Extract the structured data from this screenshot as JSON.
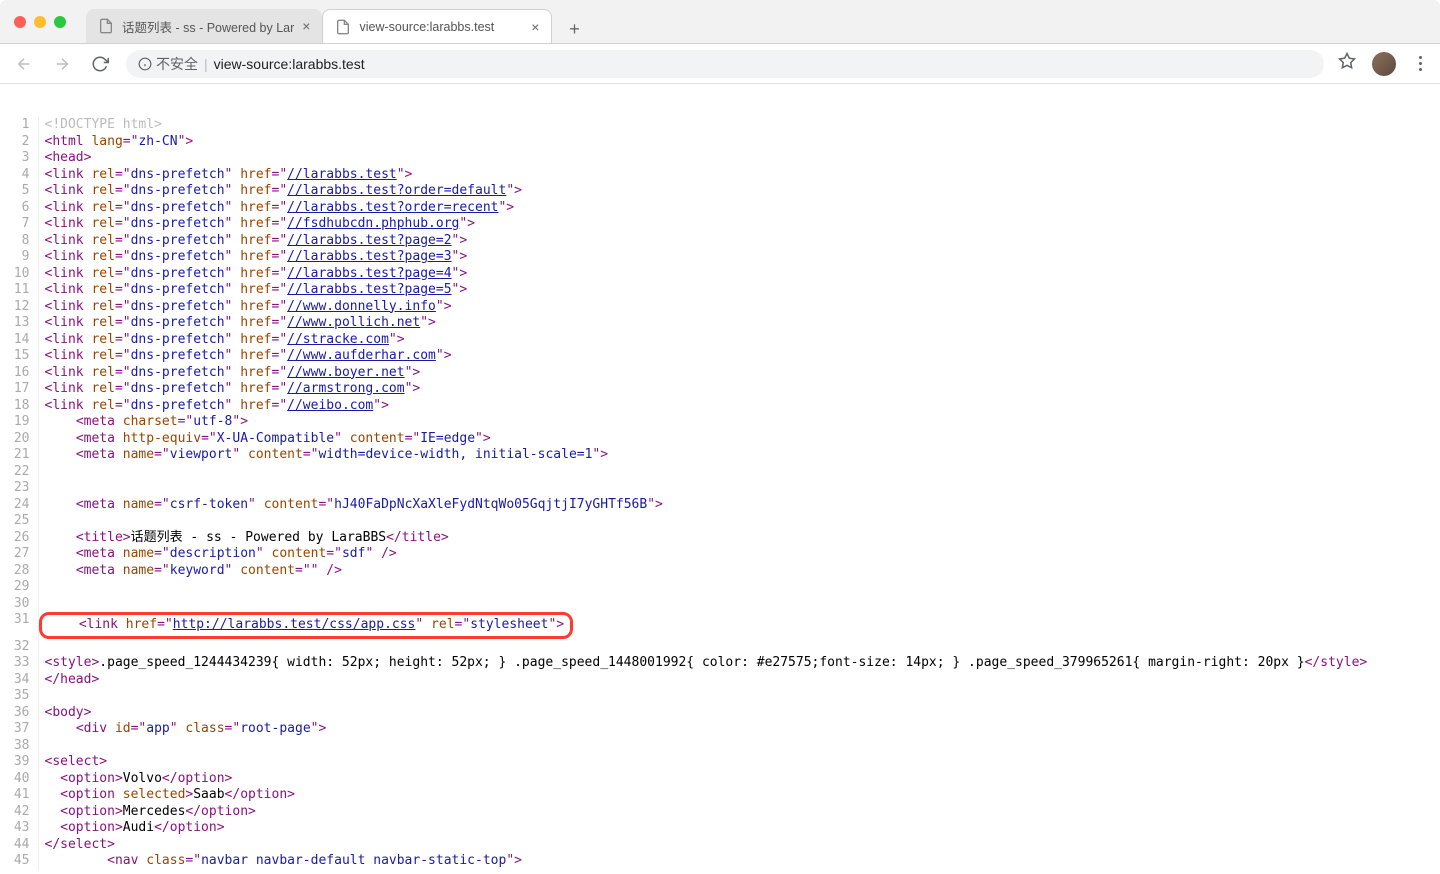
{
  "tabs": [
    {
      "title": "话题列表 - ss - Powered by Lar",
      "active": false
    },
    {
      "title": "view-source:larabbs.test",
      "active": true
    }
  ],
  "addressbar": {
    "security_label": "不安全",
    "url_prefix": "view-source:",
    "url_host": "larabbs.test"
  },
  "source_lines": [
    {
      "n": 1,
      "segs": [
        {
          "t": "doctype",
          "v": "<!DOCTYPE html>"
        }
      ]
    },
    {
      "n": 2,
      "segs": [
        {
          "t": "tag",
          "v": "<html "
        },
        {
          "t": "attr",
          "v": "lang"
        },
        {
          "t": "tag",
          "v": "=\""
        },
        {
          "t": "val",
          "v": "zh-CN"
        },
        {
          "t": "tag",
          "v": "\">"
        }
      ]
    },
    {
      "n": 3,
      "segs": [
        {
          "t": "tag",
          "v": "<head>"
        }
      ]
    },
    {
      "n": 4,
      "segs": [
        {
          "t": "tag",
          "v": "<link "
        },
        {
          "t": "attr",
          "v": "rel"
        },
        {
          "t": "tag",
          "v": "=\""
        },
        {
          "t": "val",
          "v": "dns-prefetch"
        },
        {
          "t": "tag",
          "v": "\" "
        },
        {
          "t": "attr",
          "v": "href"
        },
        {
          "t": "tag",
          "v": "=\""
        },
        {
          "t": "link",
          "v": "//larabbs.test"
        },
        {
          "t": "tag",
          "v": "\">"
        }
      ]
    },
    {
      "n": 5,
      "segs": [
        {
          "t": "tag",
          "v": "<link "
        },
        {
          "t": "attr",
          "v": "rel"
        },
        {
          "t": "tag",
          "v": "=\""
        },
        {
          "t": "val",
          "v": "dns-prefetch"
        },
        {
          "t": "tag",
          "v": "\" "
        },
        {
          "t": "attr",
          "v": "href"
        },
        {
          "t": "tag",
          "v": "=\""
        },
        {
          "t": "link",
          "v": "//larabbs.test?order=default"
        },
        {
          "t": "tag",
          "v": "\">"
        }
      ]
    },
    {
      "n": 6,
      "segs": [
        {
          "t": "tag",
          "v": "<link "
        },
        {
          "t": "attr",
          "v": "rel"
        },
        {
          "t": "tag",
          "v": "=\""
        },
        {
          "t": "val",
          "v": "dns-prefetch"
        },
        {
          "t": "tag",
          "v": "\" "
        },
        {
          "t": "attr",
          "v": "href"
        },
        {
          "t": "tag",
          "v": "=\""
        },
        {
          "t": "link",
          "v": "//larabbs.test?order=recent"
        },
        {
          "t": "tag",
          "v": "\">"
        }
      ]
    },
    {
      "n": 7,
      "segs": [
        {
          "t": "tag",
          "v": "<link "
        },
        {
          "t": "attr",
          "v": "rel"
        },
        {
          "t": "tag",
          "v": "=\""
        },
        {
          "t": "val",
          "v": "dns-prefetch"
        },
        {
          "t": "tag",
          "v": "\" "
        },
        {
          "t": "attr",
          "v": "href"
        },
        {
          "t": "tag",
          "v": "=\""
        },
        {
          "t": "link",
          "v": "//fsdhubcdn.phphub.org"
        },
        {
          "t": "tag",
          "v": "\">"
        }
      ]
    },
    {
      "n": 8,
      "segs": [
        {
          "t": "tag",
          "v": "<link "
        },
        {
          "t": "attr",
          "v": "rel"
        },
        {
          "t": "tag",
          "v": "=\""
        },
        {
          "t": "val",
          "v": "dns-prefetch"
        },
        {
          "t": "tag",
          "v": "\" "
        },
        {
          "t": "attr",
          "v": "href"
        },
        {
          "t": "tag",
          "v": "=\""
        },
        {
          "t": "link",
          "v": "//larabbs.test?page=2"
        },
        {
          "t": "tag",
          "v": "\">"
        }
      ]
    },
    {
      "n": 9,
      "segs": [
        {
          "t": "tag",
          "v": "<link "
        },
        {
          "t": "attr",
          "v": "rel"
        },
        {
          "t": "tag",
          "v": "=\""
        },
        {
          "t": "val",
          "v": "dns-prefetch"
        },
        {
          "t": "tag",
          "v": "\" "
        },
        {
          "t": "attr",
          "v": "href"
        },
        {
          "t": "tag",
          "v": "=\""
        },
        {
          "t": "link",
          "v": "//larabbs.test?page=3"
        },
        {
          "t": "tag",
          "v": "\">"
        }
      ]
    },
    {
      "n": 10,
      "segs": [
        {
          "t": "tag",
          "v": "<link "
        },
        {
          "t": "attr",
          "v": "rel"
        },
        {
          "t": "tag",
          "v": "=\""
        },
        {
          "t": "val",
          "v": "dns-prefetch"
        },
        {
          "t": "tag",
          "v": "\" "
        },
        {
          "t": "attr",
          "v": "href"
        },
        {
          "t": "tag",
          "v": "=\""
        },
        {
          "t": "link",
          "v": "//larabbs.test?page=4"
        },
        {
          "t": "tag",
          "v": "\">"
        }
      ]
    },
    {
      "n": 11,
      "segs": [
        {
          "t": "tag",
          "v": "<link "
        },
        {
          "t": "attr",
          "v": "rel"
        },
        {
          "t": "tag",
          "v": "=\""
        },
        {
          "t": "val",
          "v": "dns-prefetch"
        },
        {
          "t": "tag",
          "v": "\" "
        },
        {
          "t": "attr",
          "v": "href"
        },
        {
          "t": "tag",
          "v": "=\""
        },
        {
          "t": "link",
          "v": "//larabbs.test?page=5"
        },
        {
          "t": "tag",
          "v": "\">"
        }
      ]
    },
    {
      "n": 12,
      "segs": [
        {
          "t": "tag",
          "v": "<link "
        },
        {
          "t": "attr",
          "v": "rel"
        },
        {
          "t": "tag",
          "v": "=\""
        },
        {
          "t": "val",
          "v": "dns-prefetch"
        },
        {
          "t": "tag",
          "v": "\" "
        },
        {
          "t": "attr",
          "v": "href"
        },
        {
          "t": "tag",
          "v": "=\""
        },
        {
          "t": "link",
          "v": "//www.donnelly.info"
        },
        {
          "t": "tag",
          "v": "\">"
        }
      ]
    },
    {
      "n": 13,
      "segs": [
        {
          "t": "tag",
          "v": "<link "
        },
        {
          "t": "attr",
          "v": "rel"
        },
        {
          "t": "tag",
          "v": "=\""
        },
        {
          "t": "val",
          "v": "dns-prefetch"
        },
        {
          "t": "tag",
          "v": "\" "
        },
        {
          "t": "attr",
          "v": "href"
        },
        {
          "t": "tag",
          "v": "=\""
        },
        {
          "t": "link",
          "v": "//www.pollich.net"
        },
        {
          "t": "tag",
          "v": "\">"
        }
      ]
    },
    {
      "n": 14,
      "segs": [
        {
          "t": "tag",
          "v": "<link "
        },
        {
          "t": "attr",
          "v": "rel"
        },
        {
          "t": "tag",
          "v": "=\""
        },
        {
          "t": "val",
          "v": "dns-prefetch"
        },
        {
          "t": "tag",
          "v": "\" "
        },
        {
          "t": "attr",
          "v": "href"
        },
        {
          "t": "tag",
          "v": "=\""
        },
        {
          "t": "link",
          "v": "//stracke.com"
        },
        {
          "t": "tag",
          "v": "\">"
        }
      ]
    },
    {
      "n": 15,
      "segs": [
        {
          "t": "tag",
          "v": "<link "
        },
        {
          "t": "attr",
          "v": "rel"
        },
        {
          "t": "tag",
          "v": "=\""
        },
        {
          "t": "val",
          "v": "dns-prefetch"
        },
        {
          "t": "tag",
          "v": "\" "
        },
        {
          "t": "attr",
          "v": "href"
        },
        {
          "t": "tag",
          "v": "=\""
        },
        {
          "t": "link",
          "v": "//www.aufderhar.com"
        },
        {
          "t": "tag",
          "v": "\">"
        }
      ]
    },
    {
      "n": 16,
      "segs": [
        {
          "t": "tag",
          "v": "<link "
        },
        {
          "t": "attr",
          "v": "rel"
        },
        {
          "t": "tag",
          "v": "=\""
        },
        {
          "t": "val",
          "v": "dns-prefetch"
        },
        {
          "t": "tag",
          "v": "\" "
        },
        {
          "t": "attr",
          "v": "href"
        },
        {
          "t": "tag",
          "v": "=\""
        },
        {
          "t": "link",
          "v": "//www.boyer.net"
        },
        {
          "t": "tag",
          "v": "\">"
        }
      ]
    },
    {
      "n": 17,
      "segs": [
        {
          "t": "tag",
          "v": "<link "
        },
        {
          "t": "attr",
          "v": "rel"
        },
        {
          "t": "tag",
          "v": "=\""
        },
        {
          "t": "val",
          "v": "dns-prefetch"
        },
        {
          "t": "tag",
          "v": "\" "
        },
        {
          "t": "attr",
          "v": "href"
        },
        {
          "t": "tag",
          "v": "=\""
        },
        {
          "t": "link",
          "v": "//armstrong.com"
        },
        {
          "t": "tag",
          "v": "\">"
        }
      ]
    },
    {
      "n": 18,
      "segs": [
        {
          "t": "tag",
          "v": "<link "
        },
        {
          "t": "attr",
          "v": "rel"
        },
        {
          "t": "tag",
          "v": "=\""
        },
        {
          "t": "val",
          "v": "dns-prefetch"
        },
        {
          "t": "tag",
          "v": "\" "
        },
        {
          "t": "attr",
          "v": "href"
        },
        {
          "t": "tag",
          "v": "=\""
        },
        {
          "t": "link",
          "v": "//weibo.com"
        },
        {
          "t": "tag",
          "v": "\">"
        }
      ]
    },
    {
      "n": 19,
      "indent": 4,
      "segs": [
        {
          "t": "tag",
          "v": "<meta "
        },
        {
          "t": "attr",
          "v": "charset"
        },
        {
          "t": "tag",
          "v": "=\""
        },
        {
          "t": "val",
          "v": "utf-8"
        },
        {
          "t": "tag",
          "v": "\">"
        }
      ]
    },
    {
      "n": 20,
      "indent": 4,
      "segs": [
        {
          "t": "tag",
          "v": "<meta "
        },
        {
          "t": "attr",
          "v": "http-equiv"
        },
        {
          "t": "tag",
          "v": "=\""
        },
        {
          "t": "val",
          "v": "X-UA-Compatible"
        },
        {
          "t": "tag",
          "v": "\" "
        },
        {
          "t": "attr",
          "v": "content"
        },
        {
          "t": "tag",
          "v": "=\""
        },
        {
          "t": "val",
          "v": "IE=edge"
        },
        {
          "t": "tag",
          "v": "\">"
        }
      ]
    },
    {
      "n": 21,
      "indent": 4,
      "segs": [
        {
          "t": "tag",
          "v": "<meta "
        },
        {
          "t": "attr",
          "v": "name"
        },
        {
          "t": "tag",
          "v": "=\""
        },
        {
          "t": "val",
          "v": "viewport"
        },
        {
          "t": "tag",
          "v": "\" "
        },
        {
          "t": "attr",
          "v": "content"
        },
        {
          "t": "tag",
          "v": "=\""
        },
        {
          "t": "val",
          "v": "width=device-width, initial-scale=1"
        },
        {
          "t": "tag",
          "v": "\">"
        }
      ]
    },
    {
      "n": 22,
      "segs": []
    },
    {
      "n": 23,
      "segs": []
    },
    {
      "n": 24,
      "indent": 4,
      "segs": [
        {
          "t": "tag",
          "v": "<meta "
        },
        {
          "t": "attr",
          "v": "name"
        },
        {
          "t": "tag",
          "v": "=\""
        },
        {
          "t": "val",
          "v": "csrf-token"
        },
        {
          "t": "tag",
          "v": "\" "
        },
        {
          "t": "attr",
          "v": "content"
        },
        {
          "t": "tag",
          "v": "=\""
        },
        {
          "t": "val",
          "v": "hJ40FaDpNcXaXleFydNtqWo05GqjtjI7yGHTf56B"
        },
        {
          "t": "tag",
          "v": "\">"
        }
      ]
    },
    {
      "n": 25,
      "segs": []
    },
    {
      "n": 26,
      "indent": 4,
      "segs": [
        {
          "t": "tag",
          "v": "<title>"
        },
        {
          "t": "text",
          "v": "话题列表 - ss - Powered by LaraBBS"
        },
        {
          "t": "tag",
          "v": "</title>"
        }
      ]
    },
    {
      "n": 27,
      "indent": 4,
      "segs": [
        {
          "t": "tag",
          "v": "<meta "
        },
        {
          "t": "attr",
          "v": "name"
        },
        {
          "t": "tag",
          "v": "=\""
        },
        {
          "t": "val",
          "v": "description"
        },
        {
          "t": "tag",
          "v": "\" "
        },
        {
          "t": "attr",
          "v": "content"
        },
        {
          "t": "tag",
          "v": "=\""
        },
        {
          "t": "val",
          "v": "sdf"
        },
        {
          "t": "tag",
          "v": "\" />"
        }
      ]
    },
    {
      "n": 28,
      "indent": 4,
      "segs": [
        {
          "t": "tag",
          "v": "<meta "
        },
        {
          "t": "attr",
          "v": "name"
        },
        {
          "t": "tag",
          "v": "=\""
        },
        {
          "t": "val",
          "v": "keyword"
        },
        {
          "t": "tag",
          "v": "\" "
        },
        {
          "t": "attr",
          "v": "content"
        },
        {
          "t": "tag",
          "v": "=\""
        },
        {
          "t": "val",
          "v": ""
        },
        {
          "t": "tag",
          "v": "\" />"
        }
      ]
    },
    {
      "n": 29,
      "segs": []
    },
    {
      "n": 30,
      "segs": []
    },
    {
      "n": 31,
      "highlight": true,
      "indent": 4,
      "segs": [
        {
          "t": "tag",
          "v": "<link "
        },
        {
          "t": "attr",
          "v": "href"
        },
        {
          "t": "tag",
          "v": "=\""
        },
        {
          "t": "link",
          "v": "http://larabbs.test/css/app.css"
        },
        {
          "t": "tag",
          "v": "\" "
        },
        {
          "t": "attr",
          "v": "rel"
        },
        {
          "t": "tag",
          "v": "=\""
        },
        {
          "t": "val",
          "v": "stylesheet"
        },
        {
          "t": "tag",
          "v": "\">"
        }
      ]
    },
    {
      "n": 32,
      "segs": []
    },
    {
      "n": 33,
      "segs": [
        {
          "t": "tag",
          "v": "<style>"
        },
        {
          "t": "text",
          "v": ".page_speed_1244434239{ width: 52px; height: 52px; } .page_speed_1448001992{ color: #e27575;font-size: 14px; } .page_speed_379965261{ margin-right: 20px }"
        },
        {
          "t": "tag",
          "v": "</style>"
        }
      ]
    },
    {
      "n": 34,
      "segs": [
        {
          "t": "tag",
          "v": "</head>"
        }
      ]
    },
    {
      "n": 35,
      "segs": []
    },
    {
      "n": 36,
      "segs": [
        {
          "t": "tag",
          "v": "<body>"
        }
      ]
    },
    {
      "n": 37,
      "indent": 4,
      "segs": [
        {
          "t": "tag",
          "v": "<div "
        },
        {
          "t": "attr",
          "v": "id"
        },
        {
          "t": "tag",
          "v": "=\""
        },
        {
          "t": "val",
          "v": "app"
        },
        {
          "t": "tag",
          "v": "\" "
        },
        {
          "t": "attr",
          "v": "class"
        },
        {
          "t": "tag",
          "v": "=\""
        },
        {
          "t": "val",
          "v": "root-page"
        },
        {
          "t": "tag",
          "v": "\">"
        }
      ]
    },
    {
      "n": 38,
      "segs": []
    },
    {
      "n": 39,
      "segs": [
        {
          "t": "tag",
          "v": "<select>"
        }
      ]
    },
    {
      "n": 40,
      "indent": 2,
      "segs": [
        {
          "t": "tag",
          "v": "<option>"
        },
        {
          "t": "text",
          "v": "Volvo"
        },
        {
          "t": "tag",
          "v": "</option>"
        }
      ]
    },
    {
      "n": 41,
      "indent": 2,
      "segs": [
        {
          "t": "tag",
          "v": "<option "
        },
        {
          "t": "attr",
          "v": "selected"
        },
        {
          "t": "tag",
          "v": ">"
        },
        {
          "t": "text",
          "v": "Saab"
        },
        {
          "t": "tag",
          "v": "</option>"
        }
      ]
    },
    {
      "n": 42,
      "indent": 2,
      "segs": [
        {
          "t": "tag",
          "v": "<option>"
        },
        {
          "t": "text",
          "v": "Mercedes"
        },
        {
          "t": "tag",
          "v": "</option>"
        }
      ]
    },
    {
      "n": 43,
      "indent": 2,
      "segs": [
        {
          "t": "tag",
          "v": "<option>"
        },
        {
          "t": "text",
          "v": "Audi"
        },
        {
          "t": "tag",
          "v": "</option>"
        }
      ]
    },
    {
      "n": 44,
      "segs": [
        {
          "t": "tag",
          "v": "</select>"
        }
      ]
    },
    {
      "n": 45,
      "indent": 8,
      "segs": [
        {
          "t": "tag",
          "v": "<nav "
        },
        {
          "t": "attr",
          "v": "class"
        },
        {
          "t": "tag",
          "v": "=\""
        },
        {
          "t": "val",
          "v": "navbar navbar-default navbar-static-top"
        },
        {
          "t": "tag",
          "v": "\">"
        }
      ]
    }
  ]
}
